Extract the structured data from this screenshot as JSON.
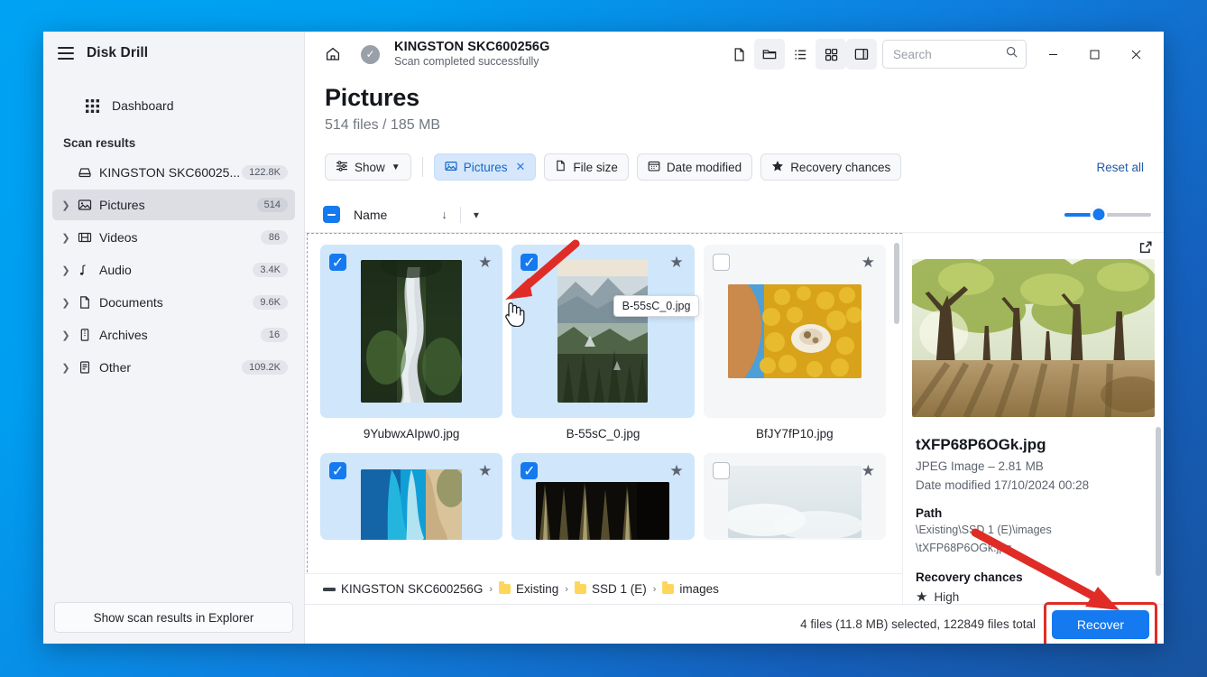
{
  "app": {
    "title": "Disk Drill",
    "menu_icon": "hamburger-icon"
  },
  "sidebar": {
    "dashboard_label": "Dashboard",
    "section_label": "Scan results",
    "items": [
      {
        "label": "KINGSTON SKC60025...",
        "badge": "122.8K",
        "icon": "disk-icon",
        "expandable": false,
        "active": false
      },
      {
        "label": "Pictures",
        "badge": "514",
        "icon": "image-icon",
        "expandable": true,
        "active": true
      },
      {
        "label": "Videos",
        "badge": "86",
        "icon": "video-icon",
        "expandable": true,
        "active": false
      },
      {
        "label": "Audio",
        "badge": "3.4K",
        "icon": "music-icon",
        "expandable": true,
        "active": false
      },
      {
        "label": "Documents",
        "badge": "9.6K",
        "icon": "document-icon",
        "expandable": true,
        "active": false
      },
      {
        "label": "Archives",
        "badge": "16",
        "icon": "archive-icon",
        "expandable": true,
        "active": false
      },
      {
        "label": "Other",
        "badge": "109.2K",
        "icon": "other-icon",
        "expandable": true,
        "active": false
      }
    ],
    "explorer_button": "Show scan results in Explorer"
  },
  "topbar": {
    "home_icon": "home-icon",
    "status_icon": "check-circle-icon",
    "device_title": "KINGSTON SKC600256G",
    "device_subtitle": "Scan completed successfully",
    "tools": [
      {
        "name": "file-view-icon",
        "active": false
      },
      {
        "name": "folder-view-icon",
        "active": true
      },
      {
        "name": "list-view-icon",
        "active": false
      },
      {
        "name": "grid-view-icon",
        "active": true
      },
      {
        "name": "panel-view-icon",
        "active": true
      }
    ],
    "search_placeholder": "Search",
    "search_value": "",
    "window_controls": {
      "minimize": "—",
      "maximize": "☐",
      "close": "✕"
    }
  },
  "page": {
    "title": "Pictures",
    "subtitle": "514 files / 185 MB"
  },
  "filters": {
    "show_label": "Show",
    "chips": [
      {
        "label": "Pictures",
        "icon": "image-icon",
        "active": true,
        "closable": true
      },
      {
        "label": "File size",
        "icon": "file-icon",
        "active": false,
        "closable": false
      },
      {
        "label": "Date modified",
        "icon": "calendar-icon",
        "active": false,
        "closable": false
      },
      {
        "label": "Recovery chances",
        "icon": "star-icon",
        "active": false,
        "closable": false
      }
    ],
    "reset_all": "Reset all"
  },
  "list_header": {
    "select_all_state": "indeterminate",
    "name_label": "Name",
    "sort_direction_icon": "arrow-down-icon",
    "chevron_icon": "chevron-down-icon",
    "zoom_slider_percent": 40
  },
  "grid": {
    "tooltip": "B-55sC_0.jpg",
    "items": [
      {
        "name": "9YubwxAIpw0.jpg",
        "selected": true,
        "starred": false,
        "thumb": "river-canyon"
      },
      {
        "name": "B-55sC_0.jpg",
        "selected": true,
        "starred": false,
        "thumb": "misty-mountains"
      },
      {
        "name": "BfJY7fP10.jpg",
        "selected": false,
        "starred": false,
        "thumb": "yellow-coral"
      },
      {
        "name": "",
        "selected": true,
        "starred": false,
        "thumb": "turquoise-beach"
      },
      {
        "name": "",
        "selected": true,
        "starred": false,
        "thumb": "dark-forest"
      },
      {
        "name": "",
        "selected": false,
        "starred": false,
        "thumb": "pale-sky"
      }
    ]
  },
  "preview": {
    "expand_icon": "external-link-icon",
    "thumb": "sunlit-forest-path",
    "filename": "tXFP68P6OGk.jpg",
    "type_size": "JPEG Image – 2.81 MB",
    "date_modified": "Date modified 17/10/2024 00:28",
    "path_label": "Path",
    "path_line1": "\\Existing\\SSD 1 (E)\\images",
    "path_line2": "\\tXFP68P6OGk.jpg",
    "recovery_label": "Recovery chances",
    "recovery_value": "High",
    "recovery_icon": "star-icon"
  },
  "breadcrumb": {
    "items": [
      {
        "label": "KINGSTON SKC600256G",
        "icon": "disk-icon"
      },
      {
        "label": "Existing",
        "icon": "folder-icon"
      },
      {
        "label": "SSD 1 (E)",
        "icon": "folder-icon"
      },
      {
        "label": "images",
        "icon": "folder-icon"
      }
    ],
    "separator": "›"
  },
  "statusbar": {
    "summary": "4 files (11.8 MB) selected, 122849 files total",
    "recover_label": "Recover"
  },
  "annotations": {
    "arrow_color": "#e02c26",
    "highlight_color": "#e02c26"
  },
  "colors": {
    "accent": "#1579ef",
    "chip_active_bg": "#d6e7fb",
    "desktop": "#00a2f3"
  }
}
